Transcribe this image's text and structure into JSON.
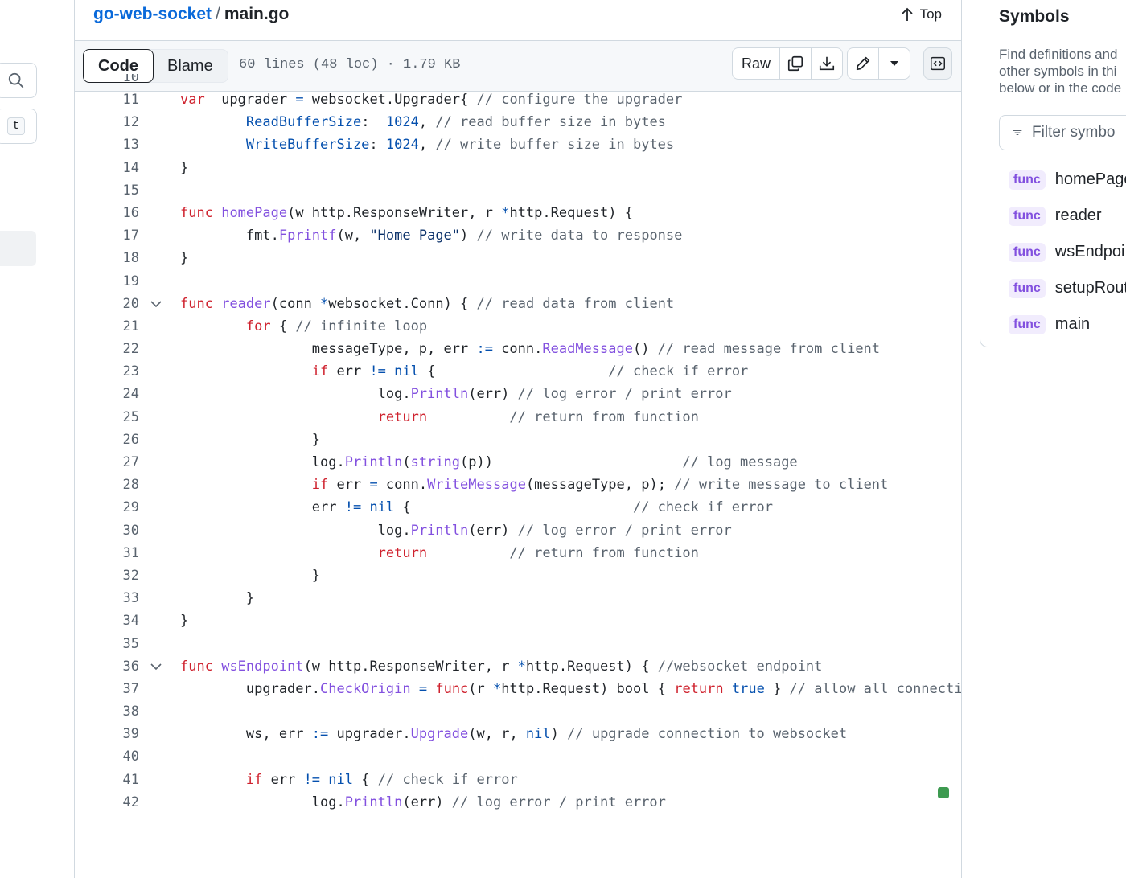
{
  "left_rail": {
    "search_icon": "search-icon",
    "shortcut_key": "t"
  },
  "file_header": {
    "repo": "go-web-socket",
    "separator": "/",
    "filename": "main.go",
    "top_label": "Top"
  },
  "toolbar": {
    "tabs": [
      {
        "label": "Code",
        "active": true
      },
      {
        "label": "Blame",
        "active": false
      }
    ],
    "file_meta": "60 lines (48 loc) · 1.79 KB",
    "raw_label": "Raw",
    "icons": [
      "copy-icon",
      "download-icon",
      "pencil-icon",
      "triangle-down-icon",
      "symbols-icon"
    ]
  },
  "symbols_panel": {
    "title": "Symbols",
    "description_lines": [
      "Find definitions and",
      "other symbols in thi",
      "below or in the code"
    ],
    "filter_placeholder": "Filter symbo",
    "items": [
      {
        "kind": "func",
        "name": "homePage"
      },
      {
        "kind": "func",
        "name": "reader"
      },
      {
        "kind": "func",
        "name": "wsEndpoi"
      },
      {
        "kind": "func",
        "name": "setupRout"
      },
      {
        "kind": "func",
        "name": "main"
      }
    ]
  },
  "code": {
    "partial_line_number": "10",
    "lines": [
      {
        "n": "11",
        "fold": false,
        "tokens": [
          [
            "k",
            "var"
          ],
          [
            "",
            "  upgrader "
          ],
          [
            "o",
            "="
          ],
          [
            "",
            " websocket.Upgrader{ "
          ],
          [
            "c",
            "// configure the upgrader"
          ]
        ]
      },
      {
        "n": "12",
        "fold": false,
        "tokens": [
          [
            "",
            "        "
          ],
          [
            "v",
            "ReadBufferSize"
          ],
          [
            "",
            ":  "
          ],
          [
            "v",
            "1024"
          ],
          [
            "",
            ", "
          ],
          [
            "c",
            "// read buffer size in bytes"
          ]
        ]
      },
      {
        "n": "13",
        "fold": false,
        "tokens": [
          [
            "",
            "        "
          ],
          [
            "v",
            "WriteBufferSize"
          ],
          [
            "",
            ": "
          ],
          [
            "v",
            "1024"
          ],
          [
            "",
            ", "
          ],
          [
            "c",
            "// write buffer size in bytes"
          ]
        ]
      },
      {
        "n": "14",
        "fold": false,
        "tokens": [
          [
            "",
            "}"
          ]
        ]
      },
      {
        "n": "15",
        "fold": false,
        "tokens": []
      },
      {
        "n": "16",
        "fold": false,
        "tokens": [
          [
            "k",
            "func"
          ],
          [
            "",
            " "
          ],
          [
            "f",
            "homePage"
          ],
          [
            "",
            "(w http.ResponseWriter, r "
          ],
          [
            "o",
            "*"
          ],
          [
            "",
            "http.Request) {"
          ]
        ]
      },
      {
        "n": "17",
        "fold": false,
        "tokens": [
          [
            "",
            "        fmt."
          ],
          [
            "f",
            "Fprintf"
          ],
          [
            "",
            "(w, "
          ],
          [
            "s",
            "\"Home Page\""
          ],
          [
            "",
            ") "
          ],
          [
            "c",
            "// write data to response"
          ]
        ]
      },
      {
        "n": "18",
        "fold": false,
        "tokens": [
          [
            "",
            "}"
          ]
        ]
      },
      {
        "n": "19",
        "fold": false,
        "tokens": []
      },
      {
        "n": "20",
        "fold": true,
        "tokens": [
          [
            "k",
            "func"
          ],
          [
            "",
            " "
          ],
          [
            "f",
            "reader"
          ],
          [
            "",
            "(conn "
          ],
          [
            "o",
            "*"
          ],
          [
            "",
            "websocket.Conn) { "
          ],
          [
            "c",
            "// read data from client"
          ]
        ]
      },
      {
        "n": "21",
        "fold": false,
        "tokens": [
          [
            "",
            "        "
          ],
          [
            "k",
            "for"
          ],
          [
            "",
            " { "
          ],
          [
            "c",
            "// infinite loop"
          ]
        ]
      },
      {
        "n": "22",
        "fold": false,
        "tokens": [
          [
            "",
            "                messageType, p, err "
          ],
          [
            "o",
            ":="
          ],
          [
            "",
            " conn."
          ],
          [
            "f",
            "ReadMessage"
          ],
          [
            "",
            "() "
          ],
          [
            "c",
            "// read message from client"
          ]
        ]
      },
      {
        "n": "23",
        "fold": false,
        "tokens": [
          [
            "",
            "                "
          ],
          [
            "k",
            "if"
          ],
          [
            "",
            " err "
          ],
          [
            "o",
            "!="
          ],
          [
            "",
            " "
          ],
          [
            "v",
            "nil"
          ],
          [
            "",
            " {                     "
          ],
          [
            "c",
            "// check if error"
          ]
        ]
      },
      {
        "n": "24",
        "fold": false,
        "tokens": [
          [
            "",
            "                        log."
          ],
          [
            "f",
            "Println"
          ],
          [
            "",
            "(err) "
          ],
          [
            "c",
            "// log error / print error"
          ]
        ]
      },
      {
        "n": "25",
        "fold": false,
        "tokens": [
          [
            "",
            "                        "
          ],
          [
            "k",
            "return"
          ],
          [
            "",
            "          "
          ],
          [
            "c",
            "// return from function"
          ]
        ]
      },
      {
        "n": "26",
        "fold": false,
        "tokens": [
          [
            "",
            "                }"
          ]
        ]
      },
      {
        "n": "27",
        "fold": false,
        "tokens": [
          [
            "",
            "                log."
          ],
          [
            "f",
            "Println"
          ],
          [
            "",
            "("
          ],
          [
            "f",
            "string"
          ],
          [
            "",
            "(p))                       "
          ],
          [
            "c",
            "// log message"
          ]
        ]
      },
      {
        "n": "28",
        "fold": false,
        "tokens": [
          [
            "",
            "                "
          ],
          [
            "k",
            "if"
          ],
          [
            "",
            " err "
          ],
          [
            "o",
            "="
          ],
          [
            "",
            " conn."
          ],
          [
            "f",
            "WriteMessage"
          ],
          [
            "",
            "(messageType, p); "
          ],
          [
            "c",
            "// write message to client"
          ]
        ]
      },
      {
        "n": "29",
        "fold": false,
        "tokens": [
          [
            "",
            "                err "
          ],
          [
            "o",
            "!="
          ],
          [
            "",
            " "
          ],
          [
            "v",
            "nil"
          ],
          [
            "",
            " {                           "
          ],
          [
            "c",
            "// check if error"
          ]
        ]
      },
      {
        "n": "30",
        "fold": false,
        "tokens": [
          [
            "",
            "                        log."
          ],
          [
            "f",
            "Println"
          ],
          [
            "",
            "(err) "
          ],
          [
            "c",
            "// log error / print error"
          ]
        ]
      },
      {
        "n": "31",
        "fold": false,
        "tokens": [
          [
            "",
            "                        "
          ],
          [
            "k",
            "return"
          ],
          [
            "",
            "          "
          ],
          [
            "c",
            "// return from function"
          ]
        ]
      },
      {
        "n": "32",
        "fold": false,
        "tokens": [
          [
            "",
            "                }"
          ]
        ]
      },
      {
        "n": "33",
        "fold": false,
        "tokens": [
          [
            "",
            "        }"
          ]
        ]
      },
      {
        "n": "34",
        "fold": false,
        "tokens": [
          [
            "",
            "}"
          ]
        ]
      },
      {
        "n": "35",
        "fold": false,
        "tokens": []
      },
      {
        "n": "36",
        "fold": true,
        "tokens": [
          [
            "k",
            "func"
          ],
          [
            "",
            " "
          ],
          [
            "f",
            "wsEndpoint"
          ],
          [
            "",
            "(w http.ResponseWriter, r "
          ],
          [
            "o",
            "*"
          ],
          [
            "",
            "http.Request) { "
          ],
          [
            "c",
            "//websocket endpoint"
          ]
        ]
      },
      {
        "n": "37",
        "fold": false,
        "tokens": [
          [
            "",
            "        upgrader."
          ],
          [
            "f",
            "CheckOrigin"
          ],
          [
            "",
            " "
          ],
          [
            "o",
            "="
          ],
          [
            "",
            " "
          ],
          [
            "k",
            "func"
          ],
          [
            "",
            "(r "
          ],
          [
            "o",
            "*"
          ],
          [
            "",
            "http.Request) bool { "
          ],
          [
            "k",
            "return"
          ],
          [
            "",
            " "
          ],
          [
            "v",
            "true"
          ],
          [
            "",
            " } "
          ],
          [
            "c",
            "// allow all connecti"
          ]
        ]
      },
      {
        "n": "38",
        "fold": false,
        "tokens": []
      },
      {
        "n": "39",
        "fold": false,
        "tokens": [
          [
            "",
            "        ws, err "
          ],
          [
            "o",
            ":="
          ],
          [
            "",
            " upgrader."
          ],
          [
            "f",
            "Upgrade"
          ],
          [
            "",
            "(w, r, "
          ],
          [
            "v",
            "nil"
          ],
          [
            "",
            ") "
          ],
          [
            "c",
            "// upgrade connection to websocket"
          ]
        ]
      },
      {
        "n": "40",
        "fold": false,
        "tokens": []
      },
      {
        "n": "41",
        "fold": false,
        "tokens": [
          [
            "",
            "        "
          ],
          [
            "k",
            "if"
          ],
          [
            "",
            " err "
          ],
          [
            "o",
            "!="
          ],
          [
            "",
            " "
          ],
          [
            "v",
            "nil"
          ],
          [
            "",
            " { "
          ],
          [
            "c",
            "// check if error"
          ]
        ]
      },
      {
        "n": "42",
        "fold": false,
        "tokens": [
          [
            "",
            "                log."
          ],
          [
            "f",
            "Println"
          ],
          [
            "",
            "(err) "
          ],
          [
            "c",
            "// log error / print error"
          ]
        ]
      }
    ]
  }
}
